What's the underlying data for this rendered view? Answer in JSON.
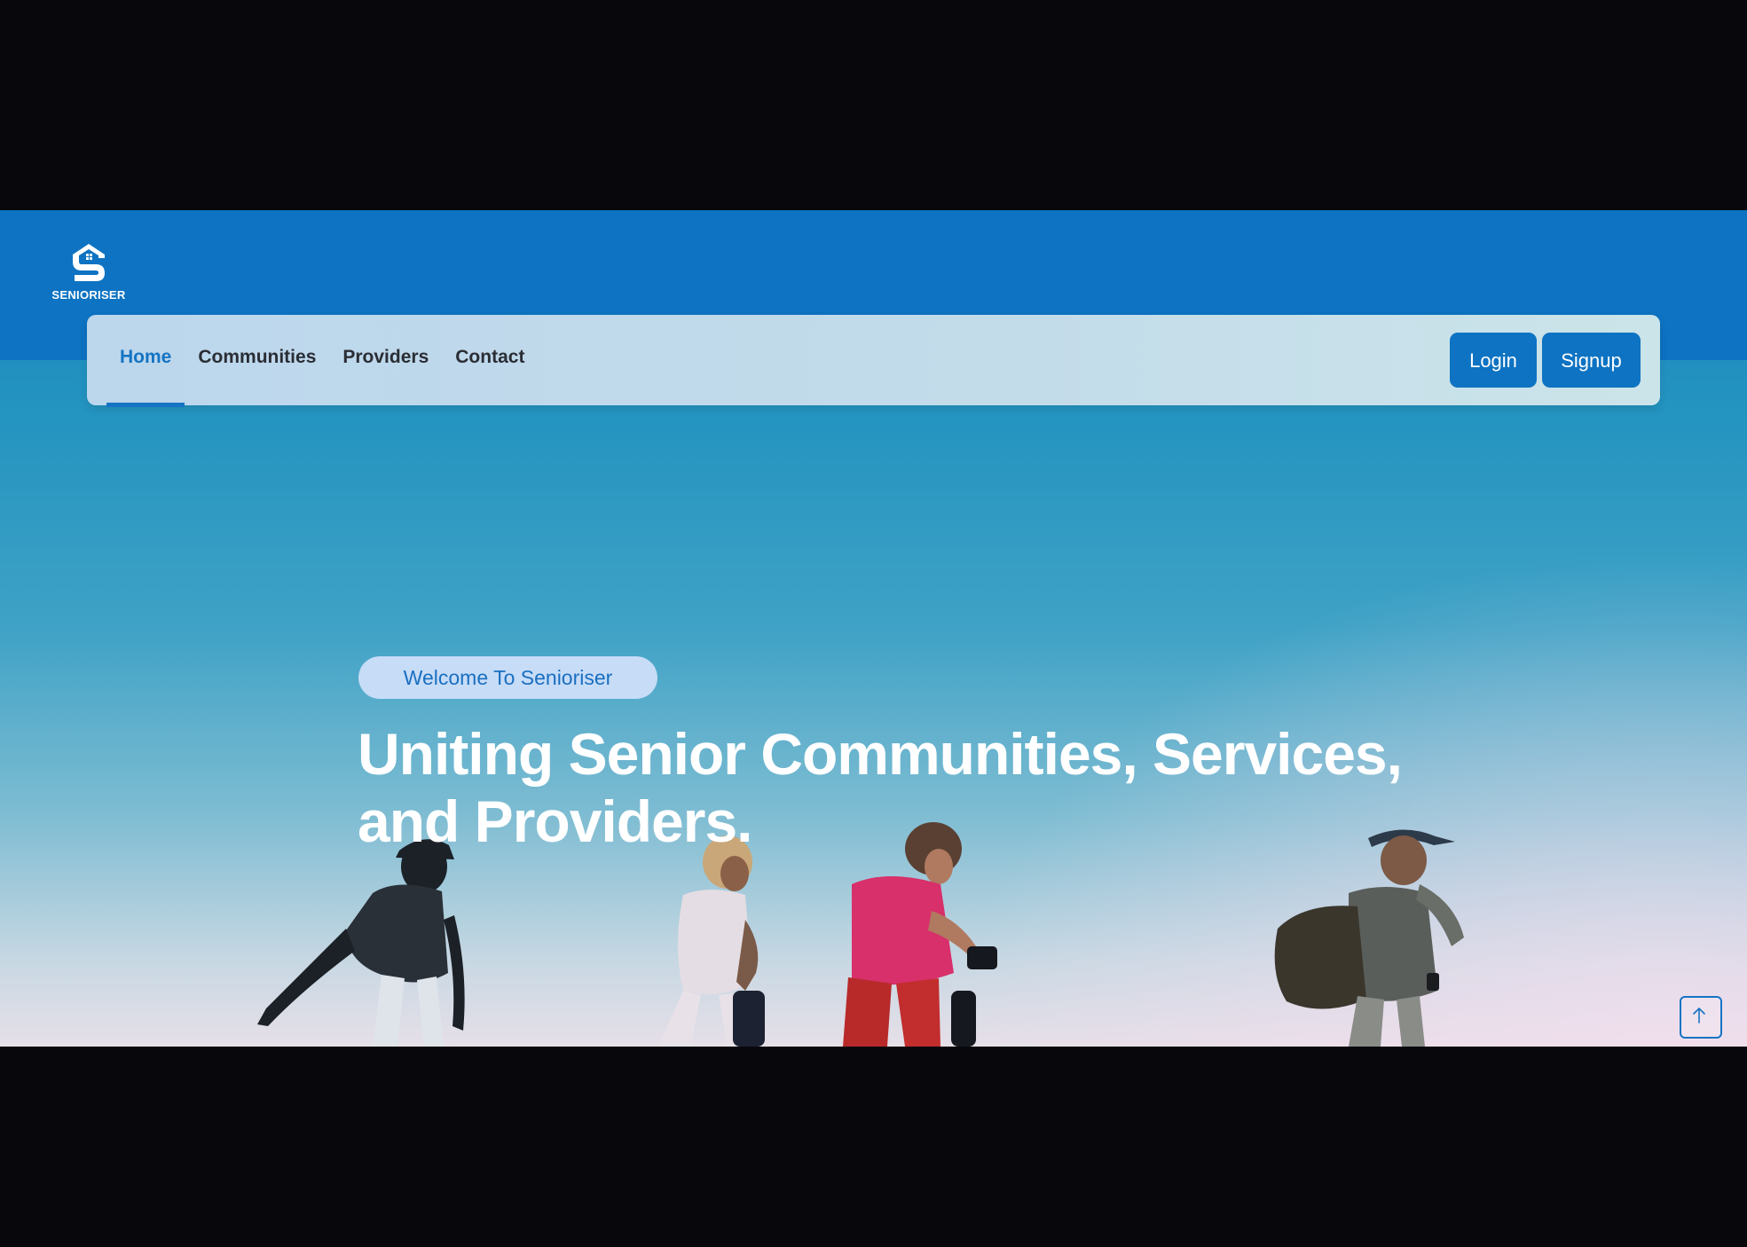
{
  "brand": {
    "name": "SENIORISER"
  },
  "nav": {
    "links": [
      {
        "label": "Home",
        "active": true
      },
      {
        "label": "Communities",
        "active": false
      },
      {
        "label": "Providers",
        "active": false
      },
      {
        "label": "Contact",
        "active": false
      }
    ],
    "login_label": "Login",
    "signup_label": "Signup"
  },
  "hero": {
    "badge": "Welcome To Senioriser",
    "title_line1": "Uniting Senior Communities, Services,",
    "title_line2": "and Providers."
  },
  "icons": {
    "logo": "house-s-logo-icon",
    "scroll_top": "arrow-up-icon"
  },
  "colors": {
    "brand_blue": "#0d73c2",
    "nav_bg": "#c3dcea",
    "badge_bg": "#c7dcf7",
    "badge_text": "#1a6fc0"
  }
}
